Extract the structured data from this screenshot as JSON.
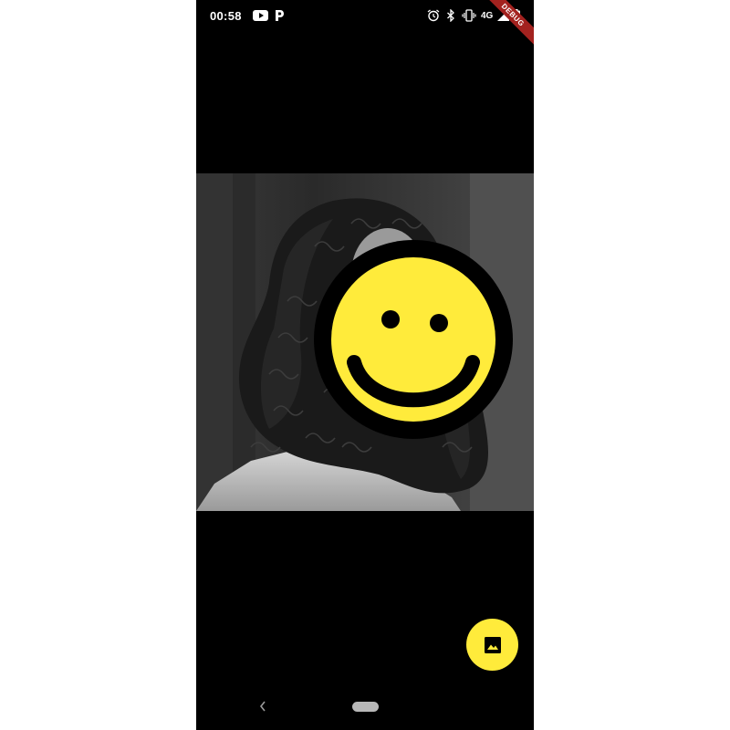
{
  "status_bar": {
    "time": "00:58",
    "network_label": "4G",
    "debug_banner": "DEBUG",
    "icons": [
      "youtube-icon",
      "p-app-icon",
      "alarm-icon",
      "bluetooth-icon",
      "vibrate-icon",
      "signal-icon",
      "battery-icon"
    ]
  },
  "main": {
    "photo": "grayscale-portrait-curly-hair",
    "overlay": "smiley-face-icon",
    "colors": {
      "smiley_fill": "#ffeb3b",
      "smiley_outline": "#000000"
    }
  },
  "fab": {
    "icon": "image-icon",
    "color": "#ffeb3b"
  },
  "nav_bar": {
    "icons": [
      "back-icon",
      "home-pill"
    ]
  }
}
